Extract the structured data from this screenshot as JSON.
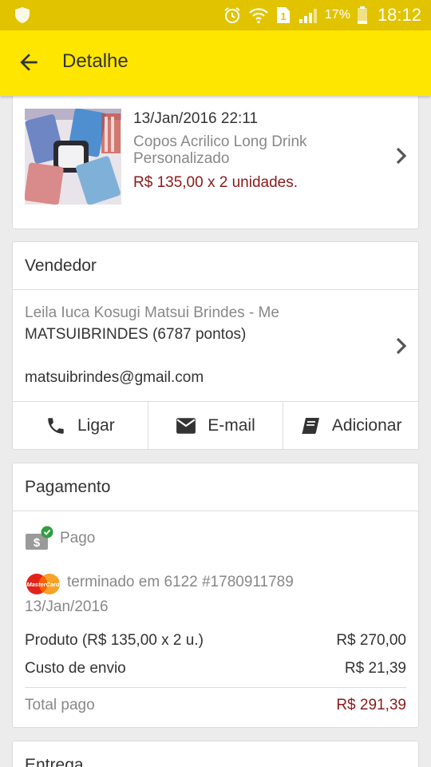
{
  "status_bar": {
    "battery_percent": "17%",
    "time": "18:12",
    "sim_label": "1"
  },
  "app_bar": {
    "title": "Detalhe"
  },
  "product": {
    "date": "13/Jan/2016 22:11",
    "name": "Copos Acrilico Long Drink Personalizado",
    "price": "R$ 135,00 x 2 unidades."
  },
  "seller": {
    "title": "Vendedor",
    "company": "Leila Iuca Kosugi Matsui Brindes - Me",
    "nickname": "MATSUIBRINDES (6787 pontos)",
    "email": "matsuibrindes@gmail.com",
    "actions": [
      {
        "label": "Ligar",
        "icon": "phone-icon"
      },
      {
        "label": "E-mail",
        "icon": "mail-icon"
      },
      {
        "label": "Adicionar",
        "icon": "contacts-book-icon"
      }
    ]
  },
  "payment": {
    "title": "Pagamento",
    "status": "Pago",
    "card_brand": "MasterCard",
    "card_info": "terminado em 6122  #1780911789",
    "date": "13/Jan/2016",
    "product_label": "Produto (R$ 135,00 x 2 u.)",
    "product_value": "R$ 270,00",
    "shipping_label": "Custo de envio",
    "shipping_value": "R$ 21,39",
    "total_label": "Total pago",
    "total_value": "R$ 291,39"
  },
  "delivery": {
    "title": "Entrega"
  },
  "colors": {
    "status_bar": "#e2c300",
    "app_bar": "#ffe600",
    "price_red": "#8b1a1a",
    "paid_green": "#2e9e3e"
  }
}
